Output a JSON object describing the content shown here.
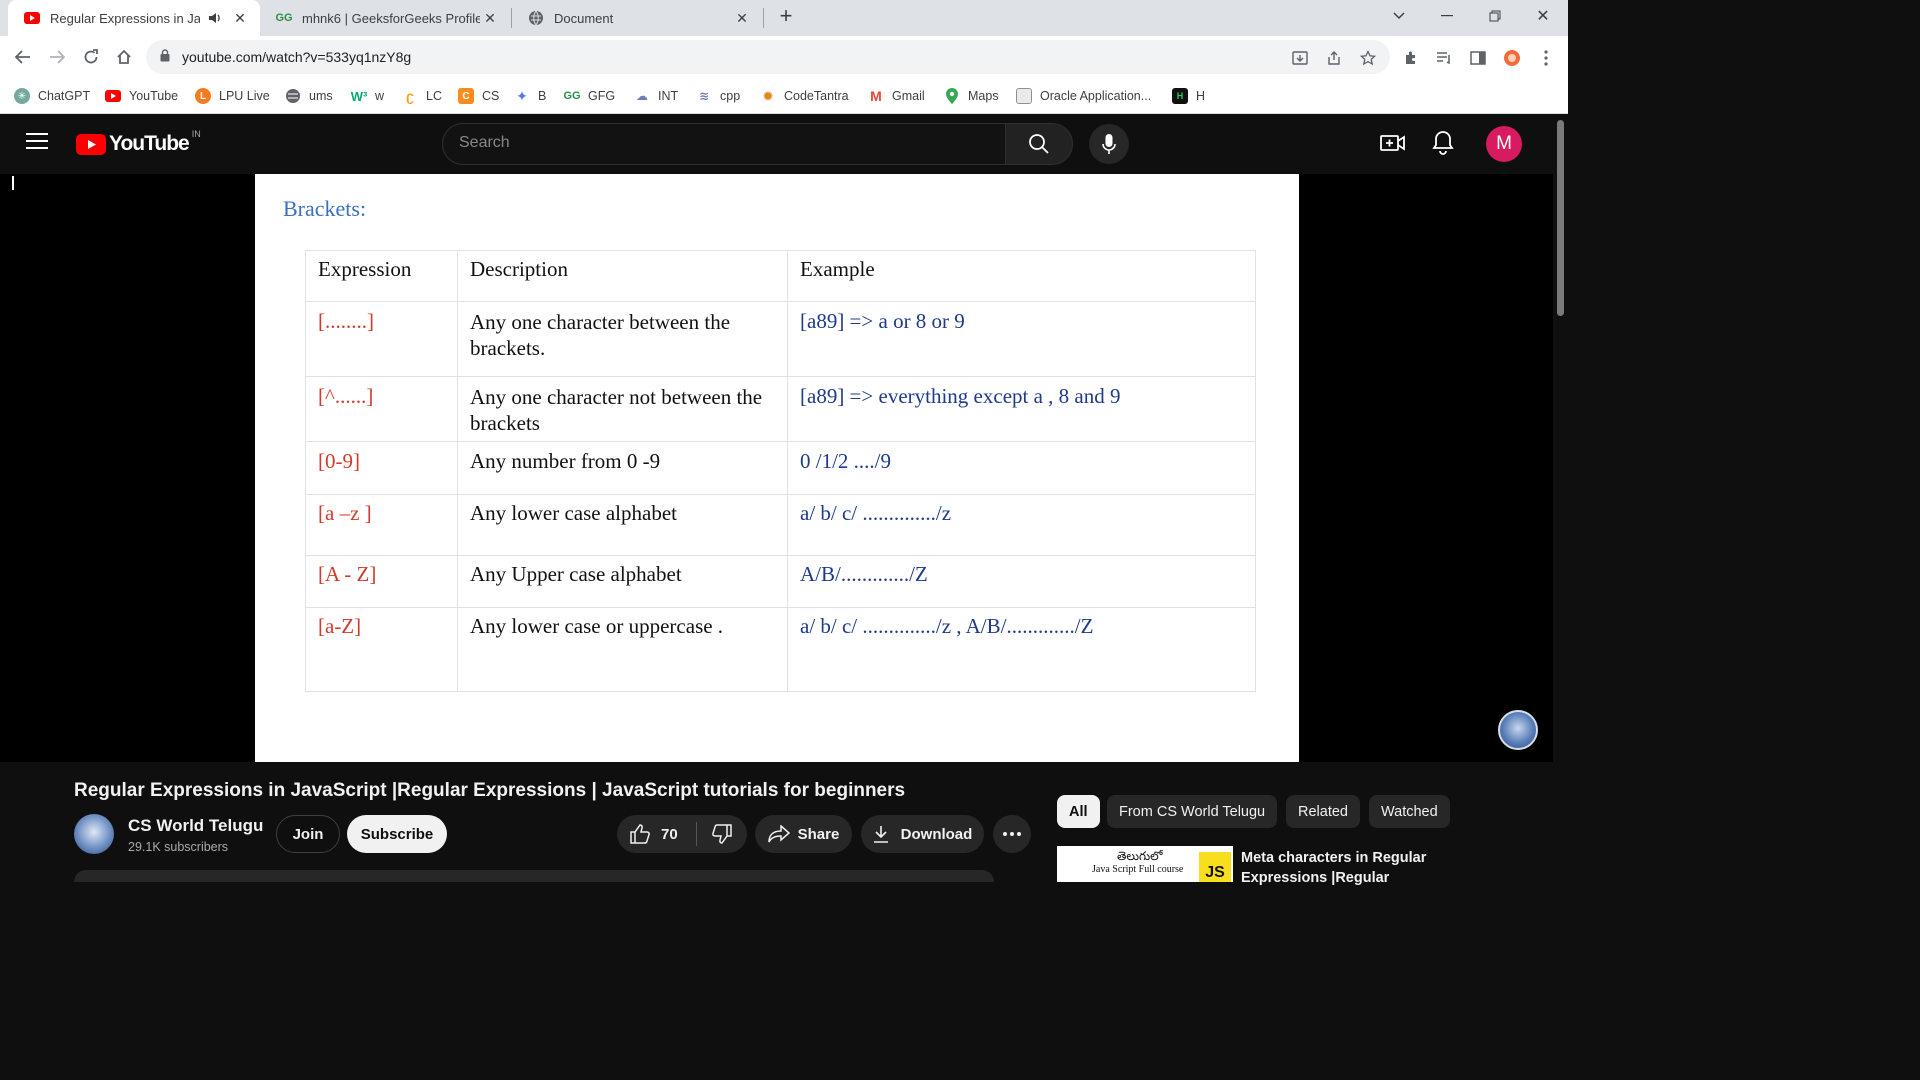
{
  "browser": {
    "tabs": [
      {
        "title": "Regular Expressions in JavaS",
        "favicon": "youtube-icon"
      },
      {
        "title": "mhnk6 | GeeksforGeeks Profile",
        "favicon": "gfg-icon"
      },
      {
        "title": "Document",
        "favicon": "globe-icon"
      }
    ],
    "url": "youtube.com/watch?v=533yq1nzY8g",
    "bookmarks": [
      "ChatGPT",
      "YouTube",
      "LPU Live",
      "ums",
      "w",
      "LC",
      "CS",
      "B",
      "GFG",
      "INT",
      "cpp",
      "CodeTantra",
      "Gmail",
      "Maps",
      "Oracle Application...",
      "H"
    ]
  },
  "youtube": {
    "logo_text": "YouTube",
    "country": "IN",
    "search_placeholder": "Search",
    "avatar_letter": "M"
  },
  "slide": {
    "title": "Brackets:",
    "headers": [
      "Expression",
      "Description",
      "Example"
    ],
    "rows": [
      {
        "expr": "[........]",
        "desc": "Any one character between the brackets.",
        "example": "[a89] => a or 8 or 9"
      },
      {
        "expr": "[^......]",
        "desc": "Any one character not between the brackets",
        "example": "[a89] => everything except a , 8  and  9"
      },
      {
        "expr": "[0-9]",
        "desc": "Any number from 0 -9",
        "example": " 0 /1/2 ..../9"
      },
      {
        "expr": "[a –z ]",
        "desc": "Any lower case alphabet",
        "example": "a/ b/ c/ ............../z"
      },
      {
        "expr": "[A  - Z]",
        "desc": "Any Upper  case alphabet",
        "example": "A/B/............./Z"
      },
      {
        "expr": "[a-Z]",
        "desc": "Any lower case or uppercase .",
        "example": "a/ b/ c/ ............../z , A/B/............./Z"
      }
    ]
  },
  "video": {
    "title": "Regular Expressions in JavaScript |Regular Expressions | JavaScript tutorials for beginners",
    "channel": "CS World Telugu",
    "subscribers": "29.1K subscribers",
    "join": "Join",
    "subscribe": "Subscribe",
    "likes": "70",
    "share": "Share",
    "download": "Download"
  },
  "chips": [
    "All",
    "From CS World Telugu",
    "Related",
    "Watched"
  ],
  "recommendation": {
    "title_line1": "Meta characters in Regular",
    "title_line2": "Expressions |Regular",
    "thumb_text1": "తెలుగులో",
    "thumb_text2": "Java Script Full course",
    "thumb_badge": "JS"
  }
}
